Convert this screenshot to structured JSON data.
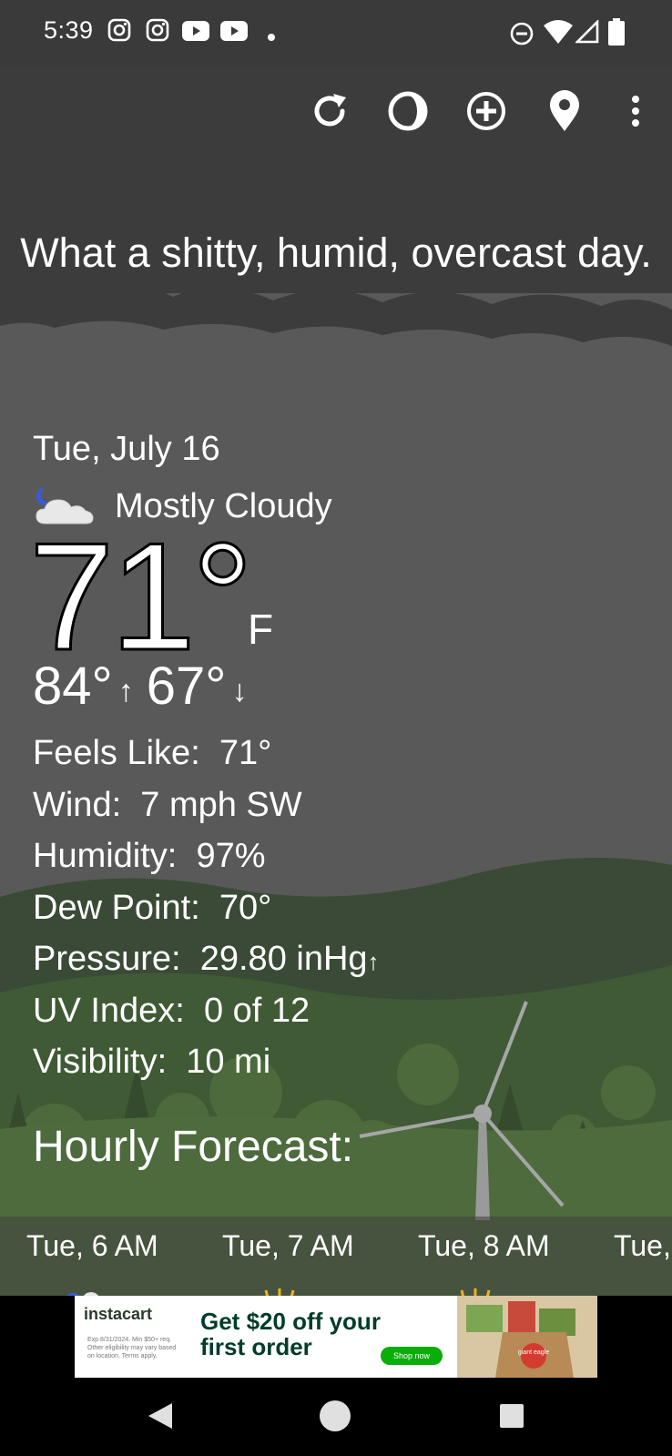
{
  "status_bar": {
    "time": "5:39",
    "left_icons": [
      "instagram-icon",
      "instagram-icon",
      "youtube-icon",
      "youtube-icon",
      "dot-icon"
    ],
    "right_icons": [
      "do-not-disturb-icon",
      "wifi-icon",
      "cell-signal-icon",
      "battery-icon"
    ]
  },
  "toolbar": {
    "actions": [
      "refresh-icon",
      "theme-icon",
      "add-location-icon",
      "location-pin-icon",
      "overflow-menu-icon"
    ]
  },
  "headline": "What a shitty, humid, overcast day.",
  "current": {
    "date": "Tue, July 16",
    "condition": "Mostly Cloudy",
    "condition_icon": "partly-cloudy-night-icon",
    "temperature": "71°",
    "unit": "F",
    "high": "84°",
    "low": "67°",
    "high_arrow": "↑",
    "low_arrow": "↓"
  },
  "details": {
    "feels_like": "Feels Like:  71°",
    "wind": "Wind:  7 mph SW",
    "humidity": "Humidity:  97%",
    "dew_point": "Dew Point:  70°",
    "pressure": "Pressure:  29.80 inHg",
    "pressure_trend": "↑",
    "uv_index": "UV Index:  0 of 12",
    "visibility": "Visibility:  10 mi"
  },
  "hourly": {
    "title": "Hourly Forecast:",
    "items": [
      "Tue, 6 AM",
      "Tue, 7 AM",
      "Tue, 8 AM",
      "Tue,"
    ]
  },
  "ad": {
    "brand": "instacart",
    "headline_1": "Get $20 off your",
    "headline_2": "first order",
    "cta": "Shop now",
    "fine_print": "Exp 8/31/2024. Min $50+ req. Other eligibility may vary based on location. Terms apply.",
    "product_label": "giant eagle"
  },
  "colors": {
    "sky": "#595959",
    "cloud_band": "#3e3e3e",
    "hills_far": "#3b4a36",
    "hills_near": "#4f6b3e",
    "status_bar": "#3a3a3a",
    "ad_green": "#0aad0a"
  }
}
